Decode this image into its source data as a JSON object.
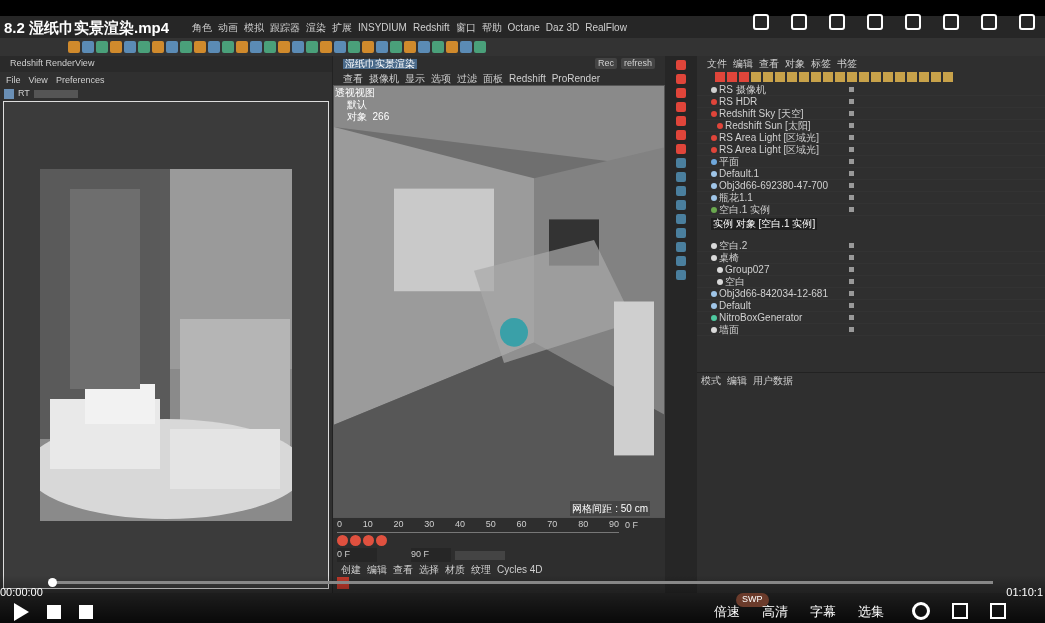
{
  "player": {
    "title": "8.2 湿纸巾实景渲染.mp4",
    "time_current": "00:00:00",
    "time_total": "01:10:1",
    "progress": {
      "level": 0
    },
    "badge": "SWP",
    "buttons": [
      "倍速",
      "高清",
      "字幕",
      "选集"
    ]
  },
  "app": {
    "menu": [
      "角色",
      "动画",
      "模拟",
      "跟踪器",
      "渲染",
      "扩展",
      "INSYDIUM",
      "Redshift",
      "窗口",
      "帮助",
      "Octane",
      "Daz 3D",
      "RealFlow"
    ],
    "render_view": {
      "title": "Redshift RenderView",
      "menu": [
        "File",
        "View",
        "Preferences"
      ],
      "rt": "RT"
    },
    "viewport": {
      "tab": "湿纸巾实景渲染",
      "buttons": [
        "Rec",
        "refresh"
      ],
      "menu": [
        "查看",
        "摄像机",
        "显示",
        "选项",
        "过滤",
        "面板",
        "Redshift",
        "ProRender"
      ],
      "camera": "透视视图",
      "hud": [
        "默认",
        "对象  266"
      ],
      "grid": "网格间距 : 50 cm"
    },
    "timeline": {
      "ticks": [
        "0",
        "10",
        "20",
        "30",
        "40",
        "50",
        "60",
        "70",
        "80",
        "90"
      ],
      "frame": "0 F",
      "start": "0 F",
      "end": "90 F"
    },
    "material_menu": [
      "创建",
      "编辑",
      "查看",
      "选择",
      "材质",
      "纹理",
      "Cycles 4D"
    ],
    "objects": {
      "menu": [
        "文件",
        "编辑",
        "查看",
        "对象",
        "标签",
        "书签"
      ],
      "rows": [
        {
          "name": "RS 摄像机",
          "kind": "camera"
        },
        {
          "name": "RS HDR",
          "kind": "light"
        },
        {
          "name": "Redshift Sky [天空]",
          "kind": "light",
          "children": [
            {
              "name": "Redshift Sun [太阳]",
              "kind": "light"
            }
          ]
        },
        {
          "name": "RS Area Light [区域光]",
          "kind": "light"
        },
        {
          "name": "RS Area Light [区域光]",
          "kind": "light"
        },
        {
          "name": "平面",
          "kind": "plane"
        },
        {
          "name": "Default.1",
          "kind": "mesh"
        },
        {
          "name": "Obj3d66-692380-47-700",
          "kind": "mesh"
        },
        {
          "name": "瓶花1.1",
          "kind": "mesh"
        },
        {
          "name": "空白.1 实例",
          "kind": "instance"
        },
        {
          "kind": "hidden"
        },
        {
          "kind": "hidden"
        },
        {
          "name": "空白.2",
          "kind": "null"
        },
        {
          "name": "桌椅",
          "kind": "null",
          "children": [
            {
              "name": "Group027",
              "kind": "null"
            },
            {
              "name": "空白",
              "kind": "null"
            }
          ]
        },
        {
          "name": "Obj3d66-842034-12-681",
          "kind": "mesh"
        },
        {
          "name": "Default",
          "kind": "mesh"
        },
        {
          "name": "NitroBoxGenerator",
          "kind": "generator"
        },
        {
          "name": "墙面",
          "kind": "null"
        }
      ]
    },
    "tooltip": "实例 对象 [空白.1 实例]",
    "attributes": {
      "menu": [
        "模式",
        "编辑",
        "用户数据"
      ]
    }
  }
}
